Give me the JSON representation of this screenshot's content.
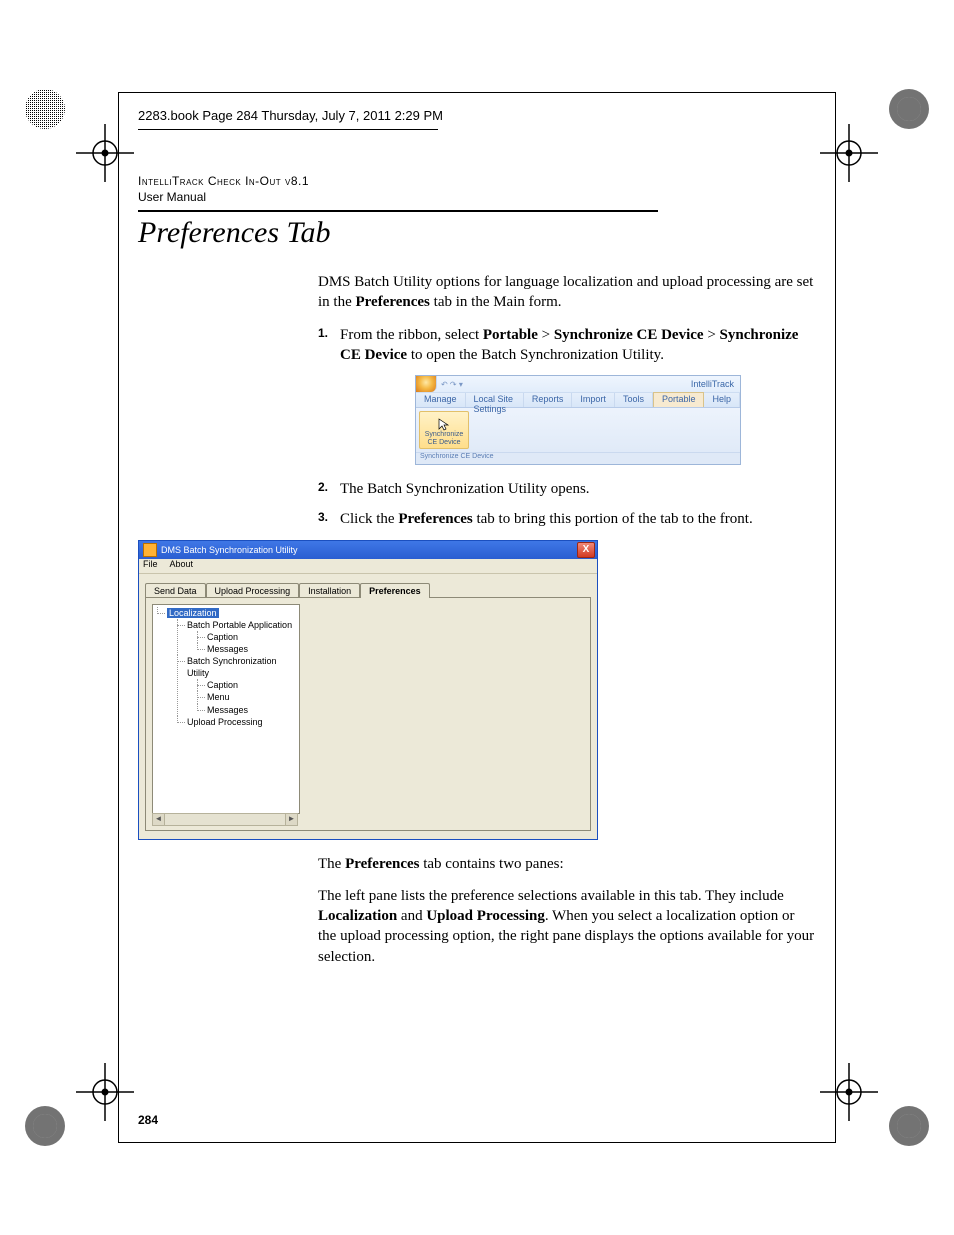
{
  "running_head": "2283.book  Page 284  Thursday, July 7, 2011  2:29 PM",
  "doc_header_line1": "IntelliTrack Check In-Out v8.1",
  "doc_header_line2": "User Manual",
  "page_title": "Preferences Tab",
  "intro_pre": "DMS Batch Utility options for language localization and upload processing are set in the ",
  "intro_bold": "Preferences",
  "intro_post": " tab in the Main form.",
  "steps": {
    "s1_num": "1.",
    "s1_a": "From the ribbon, select ",
    "s1_b1": "Portable",
    "s1_sep1": " > ",
    "s1_b2": "Synchronize CE Device",
    "s1_sep2": " > ",
    "s1_b3": "Synchronize CE Device",
    "s1_c": " to open the Batch Synchronization Utility.",
    "s2_num": "2.",
    "s2": "The Batch Synchronization Utility opens.",
    "s3_num": "3.",
    "s3_a": "Click the ",
    "s3_b": "Preferences",
    "s3_c": " tab to bring this portion of the tab to the front."
  },
  "ribbon": {
    "appname": "IntelliTrack",
    "tabs": [
      "Manage",
      "Local Site Settings",
      "Reports",
      "Import",
      "Tools",
      "Portable",
      "Help"
    ],
    "button_line1": "Synchronize",
    "button_line2": "CE Device",
    "group_label": "Synchronize CE Device"
  },
  "dialog": {
    "title": "DMS Batch Synchronization Utility",
    "menu": [
      "File",
      "About"
    ],
    "tabs": [
      "Send Data",
      "Upload Processing",
      "Installation",
      "Preferences"
    ],
    "tree": {
      "root": "Localization",
      "n1": "Batch Portable Application",
      "n1a": "Caption",
      "n1b": "Messages",
      "n2": "Batch Synchronization Utility",
      "n2a": "Caption",
      "n2b": "Menu",
      "n2c": "Messages",
      "n3": "Upload Processing"
    },
    "close": "X"
  },
  "after1_a": "The ",
  "after1_b": "Preferences",
  "after1_c": " tab contains two panes:",
  "after2_a": "The left pane lists the preference selections available in this tab. They include ",
  "after2_b1": "Localization",
  "after2_mid": " and ",
  "after2_b2": "Upload Processing",
  "after2_c": ". When you select a localization option or the upload processing option, the right pane displays the options available for your selection.",
  "page_number": "284"
}
